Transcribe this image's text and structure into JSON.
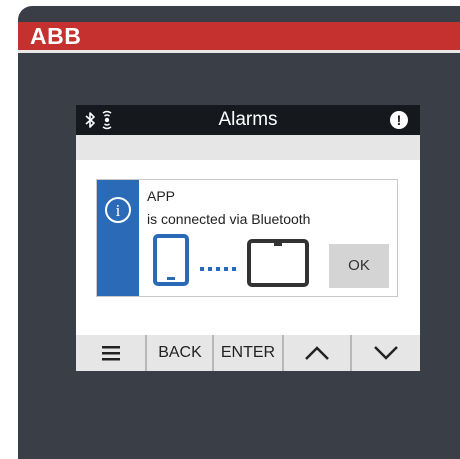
{
  "brand": {
    "logo_text": "ABB"
  },
  "screen": {
    "title": "Alarms",
    "status_icons": [
      "bluetooth-icon",
      "ble-icon",
      "alert-icon"
    ],
    "alert_symbol": "!"
  },
  "dialog": {
    "title": "APP",
    "message": "is connected via Bluetooth",
    "info_symbol": "i",
    "ok_label": "OK"
  },
  "softkeys": {
    "menu": "menu-icon",
    "back": "BACK",
    "enter": "ENTER",
    "up": "chevron-up-icon",
    "down": "chevron-down-icon"
  },
  "colors": {
    "brand_red": "#c4312e",
    "bezel": "#3a3f47",
    "titlebar": "#15181c",
    "info_blue": "#2a6ab6",
    "softbar_gray": "#e6e6e6",
    "ok_button": "#d4d4d4"
  }
}
